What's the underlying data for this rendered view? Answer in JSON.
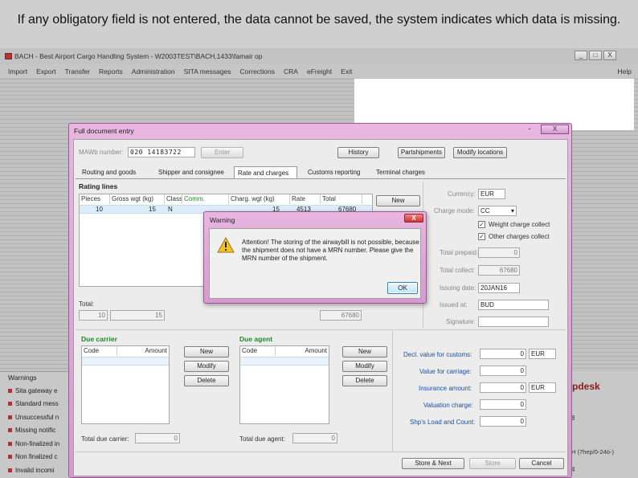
{
  "caption": "If any obligatory field is not entered, the data cannot be saved, the system indicates which data is missing.",
  "background_app": {
    "window_title": "BACH - Best Airport Cargo Handling System - W2003TEST\\BACH,1433\\famair op",
    "window_buttons": [
      "_",
      "□",
      "X"
    ],
    "menu": [
      "Import",
      "Export",
      "Transfer",
      "Reports",
      "Administration",
      "SITA messages",
      "Corrections",
      "CRA",
      "eFreight",
      "Exit"
    ],
    "help": "Help",
    "warnings_title": "Warnings",
    "warnings": [
      "Sita gateway e",
      "Standard mess",
      "Unsuccessful n",
      "Missing notific",
      "Non-finalized in",
      "Non finalized c",
      "Invalid incomi"
    ],
    "right_helpdesk": "pdesk",
    "right_frag1": "8",
    "right_frag2": "H (7hep/0-24ó-)",
    "right_frag3": "4"
  },
  "document_window": {
    "title": "Full document entry",
    "close_label": "X",
    "minimize_label": "-",
    "mawb_label": "MAWb number:",
    "mawb_value": "020 14183722",
    "enter_button": "Enter",
    "history_button": "History",
    "partshipments_button": "Partshipments",
    "modify_locations_button": "Modify locations",
    "tabs": [
      "Routing and goods",
      "Shipper and consignee",
      "Rate and charges",
      "Customs reporting",
      "Terminal charges"
    ],
    "rating_lines_title": "Rating lines",
    "rating_columns": [
      "Pieces",
      "Gross wgt (kg)",
      "Class",
      "Comm.",
      "Charg. wgt (kg)",
      "Rate",
      "Total"
    ],
    "rating_row": [
      "10",
      "15",
      "N",
      "",
      "15",
      "4513",
      "67680"
    ],
    "new_button": "New",
    "total_label": "Total:",
    "total_pieces": "10",
    "total_weight": "15",
    "total_amount": "67680",
    "currency_label": "Currency:",
    "currency_value": "EUR",
    "charge_mode_label": "Charge mode:",
    "charge_mode_value": "CC",
    "weight_charge_collect": "Weight charge collect",
    "other_charges_collect": "Other charges collect",
    "total_prepaid_label": "Total prepaid:",
    "total_prepaid_value": "0",
    "total_collect_label": "Total collect:",
    "total_collect_value": "67680",
    "issuing_date_label": "Issuing date:",
    "issuing_date_value": "20JAN16",
    "issued_at_label": "Issued at:",
    "issued_at_value": "BUD",
    "signature_label": "Signature:",
    "due_carrier_title": "Due carrier",
    "due_agent_title": "Due agent",
    "code_col": "Code",
    "amount_col": "Amount",
    "new_label": "New",
    "modify_label": "Modify",
    "delete_label": "Delete",
    "total_due_carrier_label": "Total due carrier:",
    "total_due_carrier_value": "0",
    "total_due_agent_label": "Total due agent:",
    "total_due_agent_value": "0",
    "decl_customs_label": "Decl. value for customs:",
    "decl_customs_value": "0",
    "decl_customs_currency": "EUR",
    "value_carriage_label": "Value for carriage:",
    "value_carriage_value": "0",
    "insurance_label": "Insurance amount:",
    "insurance_value": "0",
    "insurance_currency": "EUR",
    "valuation_label": "Valuation charge:",
    "valuation_value": "0",
    "shippers_load_label": "Shp's Load and Count:",
    "shippers_load_value": "0",
    "store_next_button": "Store & Next",
    "store_button": "Store",
    "cancel_button": "Cancel"
  },
  "warning_dialog": {
    "title": "Warning",
    "close_label": "X",
    "message": "Attention! The storing of the airwaybill is not possible, because the shipment does not have a MRN number. Please give the MRN number of the shipment.",
    "ok_button": "OK"
  }
}
